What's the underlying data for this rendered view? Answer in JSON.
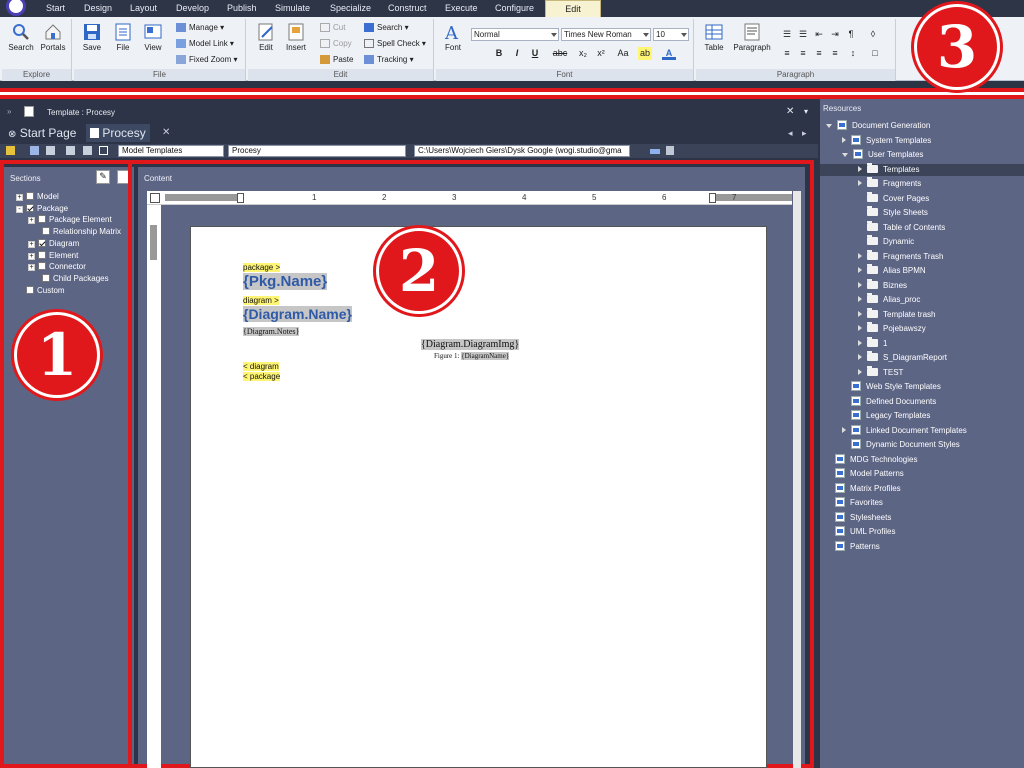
{
  "menu": {
    "tabs": [
      "Start",
      "Design",
      "Layout",
      "Develop",
      "Publish",
      "Simulate",
      "Specialize",
      "Construct",
      "Execute",
      "Configure",
      "Edit"
    ],
    "active_tab": "Edit"
  },
  "ribbon": {
    "explore": {
      "caption": "Explore",
      "search": "Search",
      "portals": "Portals"
    },
    "file": {
      "caption": "File",
      "save": "Save",
      "file": "File",
      "view": "View",
      "manage": "Manage",
      "model_link": "Model Link",
      "fixed_zoom": "Fixed Zoom"
    },
    "edit": {
      "caption": "Edit",
      "edit": "Edit",
      "insert": "Insert",
      "cut": "Cut",
      "copy": "Copy",
      "paste": "Paste",
      "search": "Search",
      "spell_check": "Spell Check",
      "tracking": "Tracking"
    },
    "font": {
      "caption": "Font",
      "font": "Font",
      "style": "Normal",
      "family": "Times New Roman",
      "size": "10",
      "bold": "B",
      "italic": "I",
      "underline": "U",
      "strike": "abc",
      "subscript": "x₂",
      "superscript": "x²",
      "case": "Aa"
    },
    "paragraph": {
      "caption": "Paragraph",
      "table": "Table",
      "paragraph": "Paragraph"
    }
  },
  "doc_window": {
    "title": "Template : Procesy",
    "tabs": [
      {
        "label": "Start Page"
      },
      {
        "label": "Procesy"
      }
    ],
    "toolbar": {
      "template_type": "Model Templates",
      "template_name": "Procesy",
      "path": "C:\\Users\\Wojciech Giers\\Dysk Google (wogi.studio@gma"
    }
  },
  "sections": {
    "header": "Sections",
    "items": [
      {
        "label": "Model",
        "checked": false,
        "expander": "+"
      },
      {
        "label": "Package",
        "checked": true,
        "expander": "−"
      },
      {
        "label": "Package Element",
        "checked": false,
        "expander": "+"
      },
      {
        "label": "Relationship Matrix",
        "checked": false,
        "expander": ""
      },
      {
        "label": "Diagram",
        "checked": true,
        "expander": "+"
      },
      {
        "label": "Element",
        "checked": false,
        "expander": "+"
      },
      {
        "label": "Connector",
        "checked": false,
        "expander": "+"
      },
      {
        "label": "Child Packages",
        "checked": false,
        "expander": ""
      },
      {
        "label": "Custom",
        "checked": false,
        "expander": ""
      }
    ]
  },
  "content": {
    "header": "Content",
    "ruler_numbers": [
      "1",
      "2",
      "3",
      "4",
      "5",
      "6",
      "7"
    ],
    "document": {
      "package_open": "package >",
      "pkg_name": "{Pkg.Name}",
      "diagram_open": "diagram >",
      "diagram_name": "{Diagram.Name}",
      "diagram_notes": "{Diagram.Notes}",
      "diagram_img": "{Diagram.DiagramImg}",
      "figure_caption_prefix": "Figure 1: ",
      "figure_caption_field": "{DiagramName}",
      "diagram_close": "< diagram",
      "package_close": "< package"
    }
  },
  "resources": {
    "header": "Resources",
    "items": [
      {
        "label": "Document Generation",
        "level": 0,
        "kind": "doc",
        "arrow": "down"
      },
      {
        "label": "System Templates",
        "level": 1,
        "kind": "doc",
        "arrow": "right"
      },
      {
        "label": "User Templates",
        "level": 1,
        "kind": "doc",
        "arrow": "down"
      },
      {
        "label": "Templates",
        "level": 2,
        "kind": "folder",
        "arrow": "right",
        "selected": true
      },
      {
        "label": "Fragments",
        "level": 2,
        "kind": "folder",
        "arrow": "right"
      },
      {
        "label": "Cover Pages",
        "level": 2,
        "kind": "folder",
        "arrow": ""
      },
      {
        "label": "Style Sheets",
        "level": 2,
        "kind": "folder",
        "arrow": ""
      },
      {
        "label": "Table of Contents",
        "level": 2,
        "kind": "folder",
        "arrow": ""
      },
      {
        "label": "Dynamic",
        "level": 2,
        "kind": "folder",
        "arrow": ""
      },
      {
        "label": "Fragments Trash",
        "level": 2,
        "kind": "folder",
        "arrow": "right"
      },
      {
        "label": "Alias BPMN",
        "level": 2,
        "kind": "folder",
        "arrow": "right"
      },
      {
        "label": "Biznes",
        "level": 2,
        "kind": "folder",
        "arrow": "right"
      },
      {
        "label": "Alias_proc",
        "level": 2,
        "kind": "folder",
        "arrow": "right"
      },
      {
        "label": "Template trash",
        "level": 2,
        "kind": "folder",
        "arrow": "right"
      },
      {
        "label": "Pojebawszy",
        "level": 2,
        "kind": "folder",
        "arrow": "right"
      },
      {
        "label": "1",
        "level": 2,
        "kind": "folder",
        "arrow": "right"
      },
      {
        "label": "S_DiagramReport",
        "level": 2,
        "kind": "folder",
        "arrow": "right"
      },
      {
        "label": "TEST",
        "level": 2,
        "kind": "folder",
        "arrow": "right"
      },
      {
        "label": "Web Style Templates",
        "level": 1,
        "kind": "doc",
        "arrow": ""
      },
      {
        "label": "Defined Documents",
        "level": 1,
        "kind": "doc",
        "arrow": ""
      },
      {
        "label": "Legacy Templates",
        "level": 1,
        "kind": "doc",
        "arrow": ""
      },
      {
        "label": "Linked Document Templates",
        "level": 1,
        "kind": "doc",
        "arrow": "right"
      },
      {
        "label": "Dynamic Document Styles",
        "level": 1,
        "kind": "doc",
        "arrow": ""
      },
      {
        "label": "MDG Technologies",
        "level": 0,
        "kind": "doc",
        "arrow": ""
      },
      {
        "label": "Model Patterns",
        "level": 0,
        "kind": "doc",
        "arrow": ""
      },
      {
        "label": "Matrix Profiles",
        "level": 0,
        "kind": "doc",
        "arrow": ""
      },
      {
        "label": "Favorites",
        "level": 0,
        "kind": "doc",
        "arrow": ""
      },
      {
        "label": "Stylesheets",
        "level": 0,
        "kind": "doc",
        "arrow": ""
      },
      {
        "label": "UML Profiles",
        "level": 0,
        "kind": "doc",
        "arrow": ""
      },
      {
        "label": "Patterns",
        "level": 0,
        "kind": "doc",
        "arrow": ""
      }
    ]
  },
  "badges": [
    "1",
    "2",
    "3"
  ],
  "colors": {
    "annotation_red": "#e0181b",
    "panel": "#5d6585",
    "dark": "#2d3447",
    "highlight": "#fff574"
  }
}
